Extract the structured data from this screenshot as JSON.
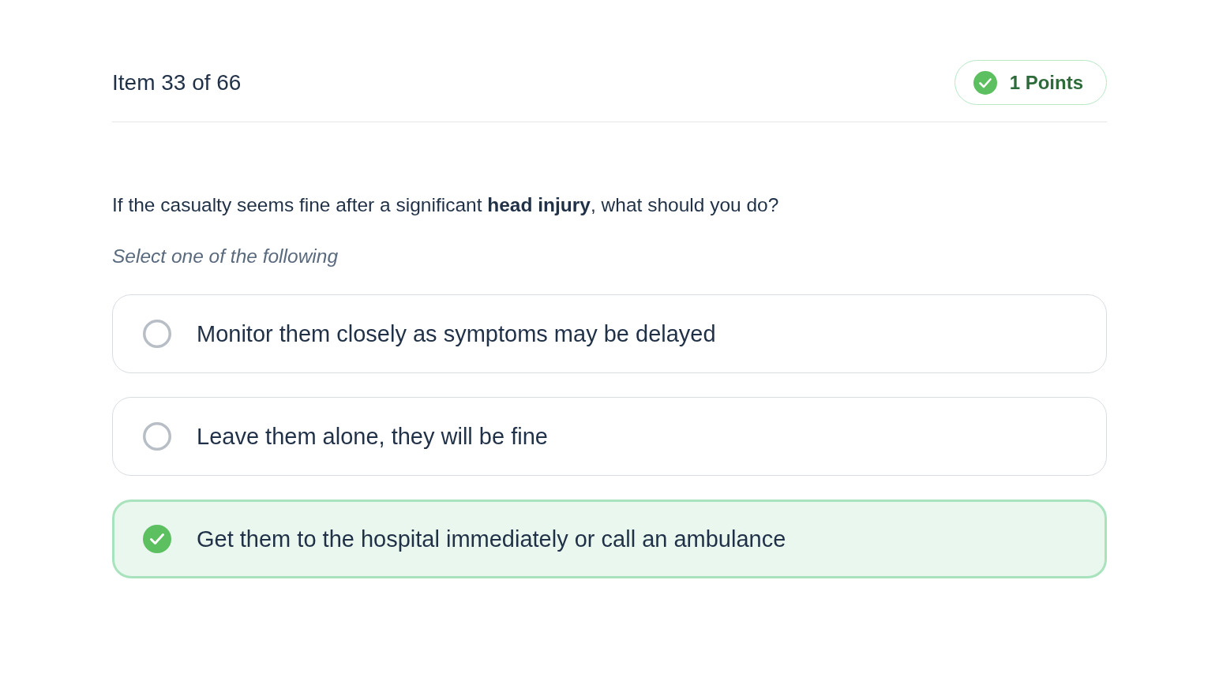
{
  "header": {
    "item_counter": "Item 33 of 66",
    "points_badge": {
      "label": "1 Points",
      "correct": true
    }
  },
  "question": {
    "text": "If the casualty seems fine after a significant **head injury**, what should you do?",
    "instruction": "Select one of the following"
  },
  "options": [
    {
      "label": "Monitor them closely as symptoms may be delayed",
      "selected": false
    },
    {
      "label": "Leave them alone, they will be fine",
      "selected": false
    },
    {
      "label": "Get them to the hospital immediately or call an ambulance",
      "selected": true
    }
  ]
}
